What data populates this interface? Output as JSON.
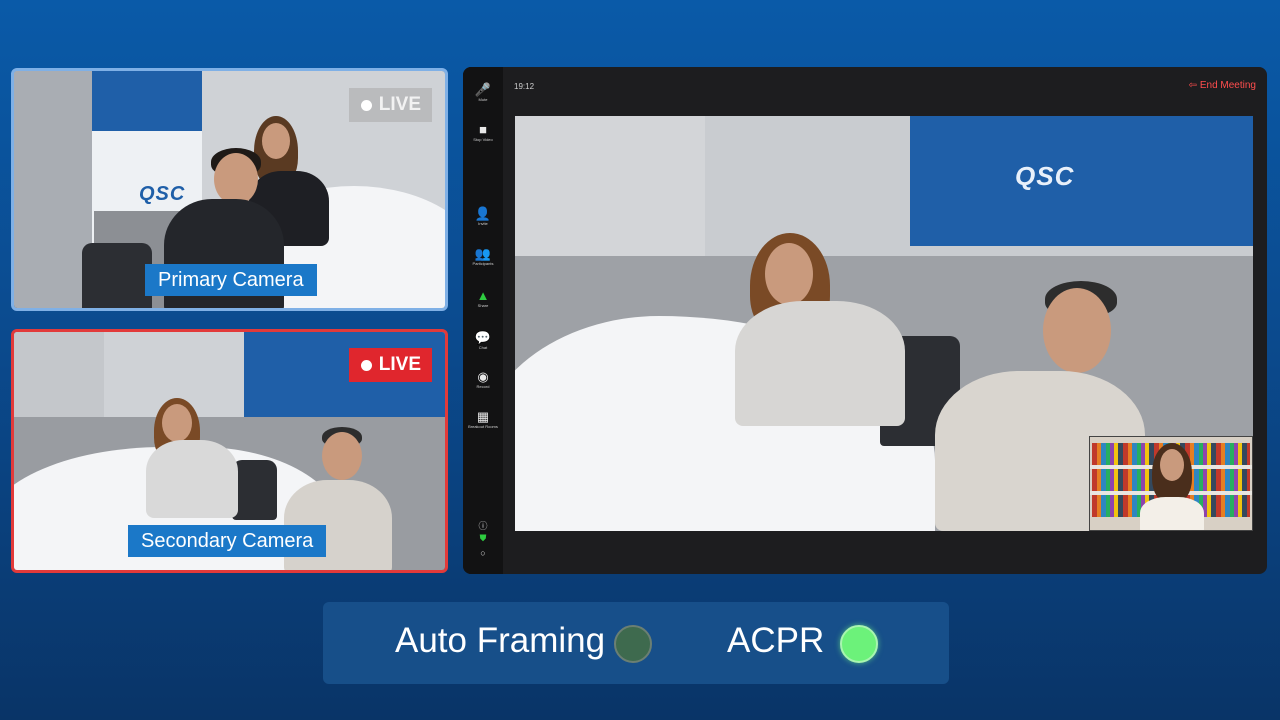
{
  "cameras": {
    "primary": {
      "label": "Primary Camera",
      "live": "LIVE"
    },
    "secondary": {
      "label": "Secondary Camera",
      "live": "LIVE"
    }
  },
  "banner": {
    "logo_text": "QSC"
  },
  "meeting": {
    "time": "19:12",
    "end_label": "End Meeting",
    "toolbar": [
      {
        "label": "Mute",
        "icon": "microphone-icon"
      },
      {
        "label": "Stop Video",
        "icon": "video-camera-icon"
      },
      {
        "label": "Invite",
        "icon": "add-user-icon"
      },
      {
        "label": "Participants",
        "icon": "participants-icon"
      },
      {
        "label": "Share",
        "icon": "share-screen-icon"
      },
      {
        "label": "Chat",
        "icon": "chat-icon"
      },
      {
        "label": "Record",
        "icon": "record-icon"
      },
      {
        "label": "Breakout Rooms",
        "icon": "breakout-rooms-icon"
      }
    ]
  },
  "status": {
    "auto_framing": {
      "label": "Auto Framing",
      "state": "off",
      "color": "#3e6a4e"
    },
    "acpr": {
      "label": "ACPR",
      "state": "on",
      "color": "#6cf27a"
    }
  },
  "colors": {
    "live_active": "#e0262d",
    "accent": "#1b78c8",
    "end_meeting": "#ff4d4d"
  }
}
